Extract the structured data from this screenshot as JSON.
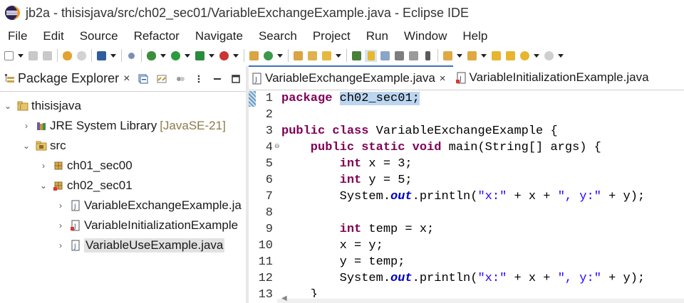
{
  "window": {
    "title": "jb2a - thisisjava/src/ch02_sec01/VariableExchangeExample.java - Eclipse IDE"
  },
  "menu": [
    "File",
    "Edit",
    "Source",
    "Refactor",
    "Navigate",
    "Search",
    "Project",
    "Run",
    "Window",
    "Help"
  ],
  "package_explorer": {
    "tab_label": "Package Explorer",
    "close_glyph": "×",
    "tree": [
      {
        "label": "thisisjava",
        "deco": "",
        "twisty": "⌄",
        "icon": "project-icon",
        "level": 0
      },
      {
        "label": "JRE System Library",
        "deco": "[JavaSE-21]",
        "twisty": "›",
        "icon": "library-icon",
        "level": 1
      },
      {
        "label": "src",
        "deco": "",
        "twisty": "⌄",
        "icon": "source-folder-icon",
        "level": 1
      },
      {
        "label": "ch01_sec00",
        "deco": "",
        "twisty": "›",
        "icon": "package-icon",
        "level": 2
      },
      {
        "label": "ch02_sec01",
        "deco": "",
        "twisty": "⌄",
        "icon": "package-icon",
        "level": 2
      },
      {
        "label": "VariableExchangeExample.ja",
        "deco": "",
        "twisty": "›",
        "icon": "java-file-icon",
        "level": 3
      },
      {
        "label": "VariableInitializationExample",
        "deco": "",
        "twisty": "›",
        "icon": "java-file-error-icon",
        "level": 3
      },
      {
        "label": "VariableUseExample.java",
        "deco": "",
        "twisty": "›",
        "icon": "java-file-icon",
        "level": 3,
        "selected": true
      }
    ]
  },
  "editor": {
    "tabs": [
      {
        "label": "VariableExchangeExample.java",
        "active": true,
        "close": "×"
      },
      {
        "label": "VariableInitializationExample.java",
        "active": false,
        "close": ""
      }
    ],
    "lines": [
      {
        "no": "1",
        "tokens": [
          {
            "t": "package ",
            "c": "kw"
          },
          {
            "t": "ch02_sec01;",
            "c": "hl"
          }
        ]
      },
      {
        "no": "2",
        "tokens": []
      },
      {
        "no": "3",
        "tokens": [
          {
            "t": "public class ",
            "c": "kw"
          },
          {
            "t": "VariableExchangeExample {",
            "c": ""
          }
        ]
      },
      {
        "no": "4",
        "fold": "⊖",
        "tokens": [
          {
            "t": "    public static void ",
            "c": "kw"
          },
          {
            "t": "main(String[] args) {",
            "c": ""
          }
        ]
      },
      {
        "no": "5",
        "tokens": [
          {
            "t": "        int ",
            "c": "kw"
          },
          {
            "t": "x = 3;",
            "c": ""
          }
        ]
      },
      {
        "no": "6",
        "tokens": [
          {
            "t": "        int ",
            "c": "kw"
          },
          {
            "t": "y = 5;",
            "c": ""
          }
        ]
      },
      {
        "no": "7",
        "tokens": [
          {
            "t": "        System.",
            "c": ""
          },
          {
            "t": "out",
            "c": "it"
          },
          {
            "t": ".println(",
            "c": ""
          },
          {
            "t": "\"x:\"",
            "c": "str"
          },
          {
            "t": " + x + ",
            "c": ""
          },
          {
            "t": "\", y:\"",
            "c": "str"
          },
          {
            "t": " + y);",
            "c": ""
          }
        ]
      },
      {
        "no": "8",
        "tokens": []
      },
      {
        "no": "9",
        "tokens": [
          {
            "t": "        int ",
            "c": "kw"
          },
          {
            "t": "temp = x;",
            "c": ""
          }
        ]
      },
      {
        "no": "10",
        "tokens": [
          {
            "t": "        x = y;",
            "c": ""
          }
        ]
      },
      {
        "no": "11",
        "tokens": [
          {
            "t": "        y = temp;",
            "c": ""
          }
        ]
      },
      {
        "no": "12",
        "tokens": [
          {
            "t": "        System.",
            "c": ""
          },
          {
            "t": "out",
            "c": "it"
          },
          {
            "t": ".println(",
            "c": ""
          },
          {
            "t": "\"x:\"",
            "c": "str"
          },
          {
            "t": " + x + ",
            "c": ""
          },
          {
            "t": "\", y:\"",
            "c": "str"
          },
          {
            "t": " + y);",
            "c": ""
          }
        ]
      },
      {
        "no": "13",
        "tokens": [
          {
            "t": "    }",
            "c": ""
          }
        ]
      }
    ]
  },
  "colors": {
    "keyword": "#7f0055",
    "string": "#2a00ff",
    "static_field": "#0000c0",
    "selection": "#bcd6f0",
    "active_tab_accent": "#3b73b9"
  }
}
